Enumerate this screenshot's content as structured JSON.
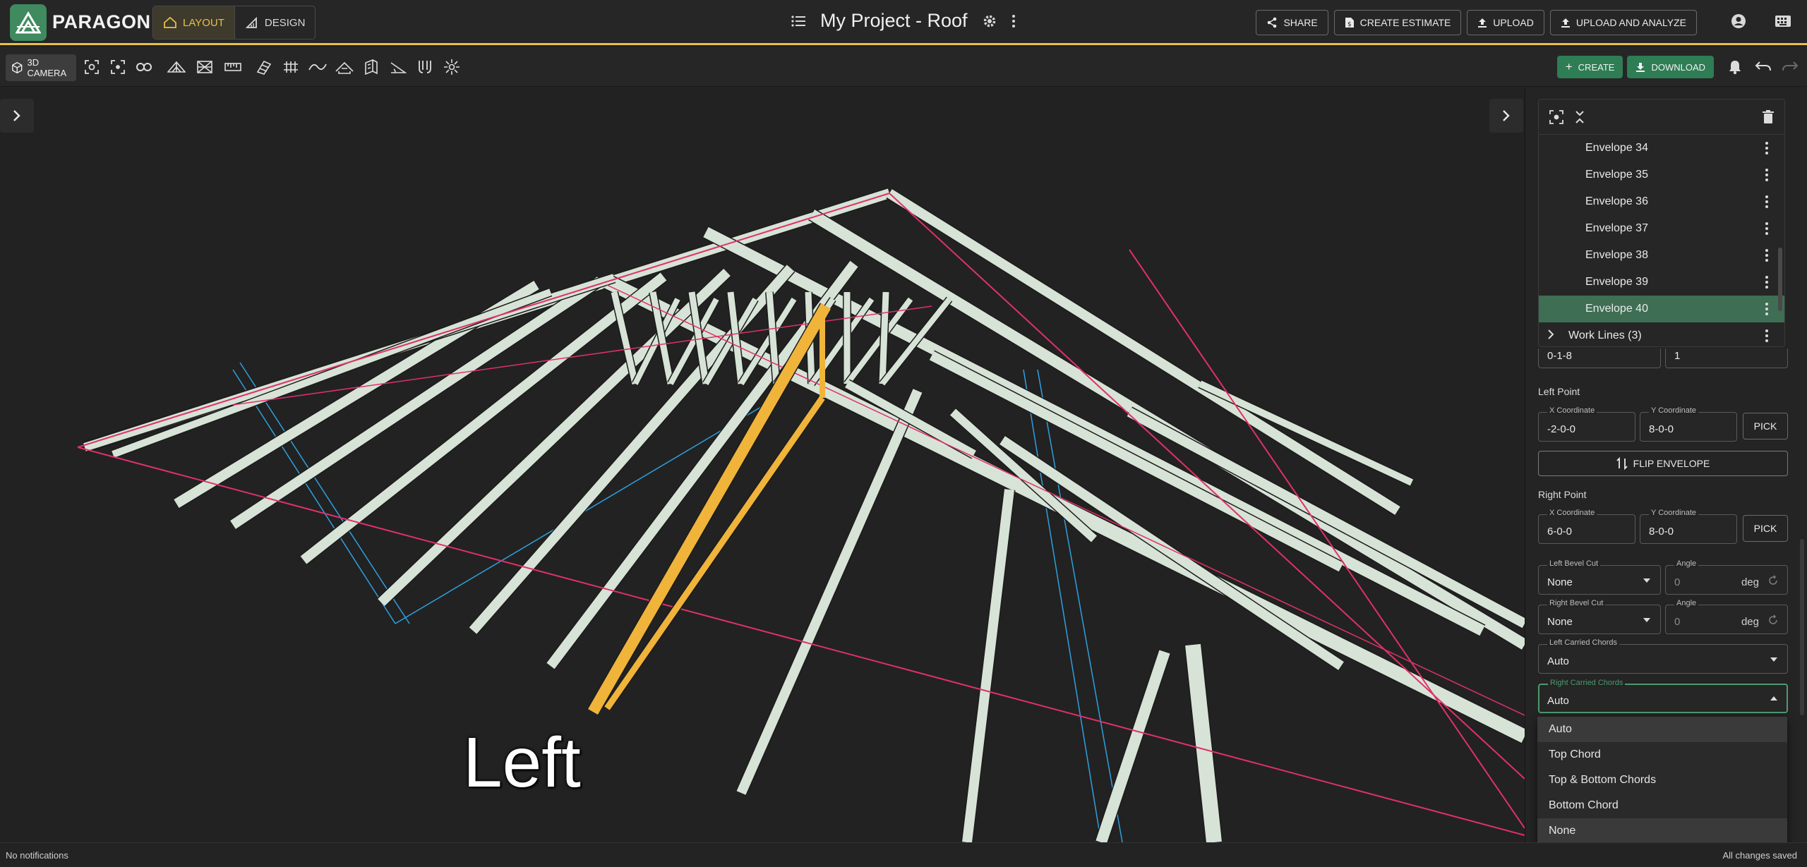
{
  "app": {
    "brand": "PARAGON",
    "modes": [
      {
        "label": "LAYOUT",
        "icon": "house-icon",
        "active": true
      },
      {
        "label": "DESIGN",
        "icon": "ruler-triangle-icon",
        "active": false
      }
    ],
    "project_title": "My Project - Roof",
    "top_actions": [
      {
        "label": "SHARE",
        "icon": "share-icon"
      },
      {
        "label": "CREATE ESTIMATE",
        "icon": "document-dollar-icon"
      },
      {
        "label": "UPLOAD",
        "icon": "upload-icon"
      },
      {
        "label": "UPLOAD AND ANALYZE",
        "icon": "upload-icon"
      }
    ]
  },
  "toolbar": {
    "camera_label": "3D CAMERA",
    "create_label": "CREATE",
    "download_label": "DOWNLOAD"
  },
  "viewport": {
    "view_label": "Left",
    "highlight_color": "#f0b43a",
    "member_color": "#d7e3d6",
    "envelope_line_color": "#e0306a",
    "work_line_color": "#2ea0e0"
  },
  "panel": {
    "tree": {
      "items": [
        {
          "label": "Envelope 34"
        },
        {
          "label": "Envelope 35"
        },
        {
          "label": "Envelope 36"
        },
        {
          "label": "Envelope 37"
        },
        {
          "label": "Envelope 38"
        },
        {
          "label": "Envelope 39"
        },
        {
          "label": "Envelope 40",
          "selected": true
        }
      ],
      "group": {
        "label": "Work Lines (3)"
      }
    },
    "partial_fields": {
      "left_value": "0-1-8",
      "right_value": "1"
    },
    "left_point": {
      "title": "Left Point",
      "x_label": "X Coordinate",
      "x_value": "-2-0-0",
      "y_label": "Y Coordinate",
      "y_value": "8-0-0",
      "pick_label": "PICK"
    },
    "flip_label": "FLIP ENVELOPE",
    "right_point": {
      "title": "Right Point",
      "x_label": "X Coordinate",
      "x_value": "6-0-0",
      "y_label": "Y Coordinate",
      "y_value": "8-0-0",
      "pick_label": "PICK"
    },
    "left_bevel": {
      "label": "Left Bevel Cut",
      "value": "None",
      "angle_label": "Angle",
      "angle_placeholder": "0",
      "unit": "deg"
    },
    "right_bevel": {
      "label": "Right Bevel Cut",
      "value": "None",
      "angle_label": "Angle",
      "angle_placeholder": "0",
      "unit": "deg"
    },
    "left_carried": {
      "label": "Left Carried Chords",
      "value": "Auto"
    },
    "right_carried": {
      "label": "Right Carried Chords",
      "value": "Auto"
    },
    "dropdown_options": [
      {
        "label": "Auto",
        "highlighted": true
      },
      {
        "label": "Top Chord"
      },
      {
        "label": "Top & Bottom Chords"
      },
      {
        "label": "Bottom Chord"
      },
      {
        "label": "None",
        "highlighted": true
      }
    ]
  },
  "status": {
    "notifications": "No notifications",
    "save_state": "All changes saved"
  }
}
